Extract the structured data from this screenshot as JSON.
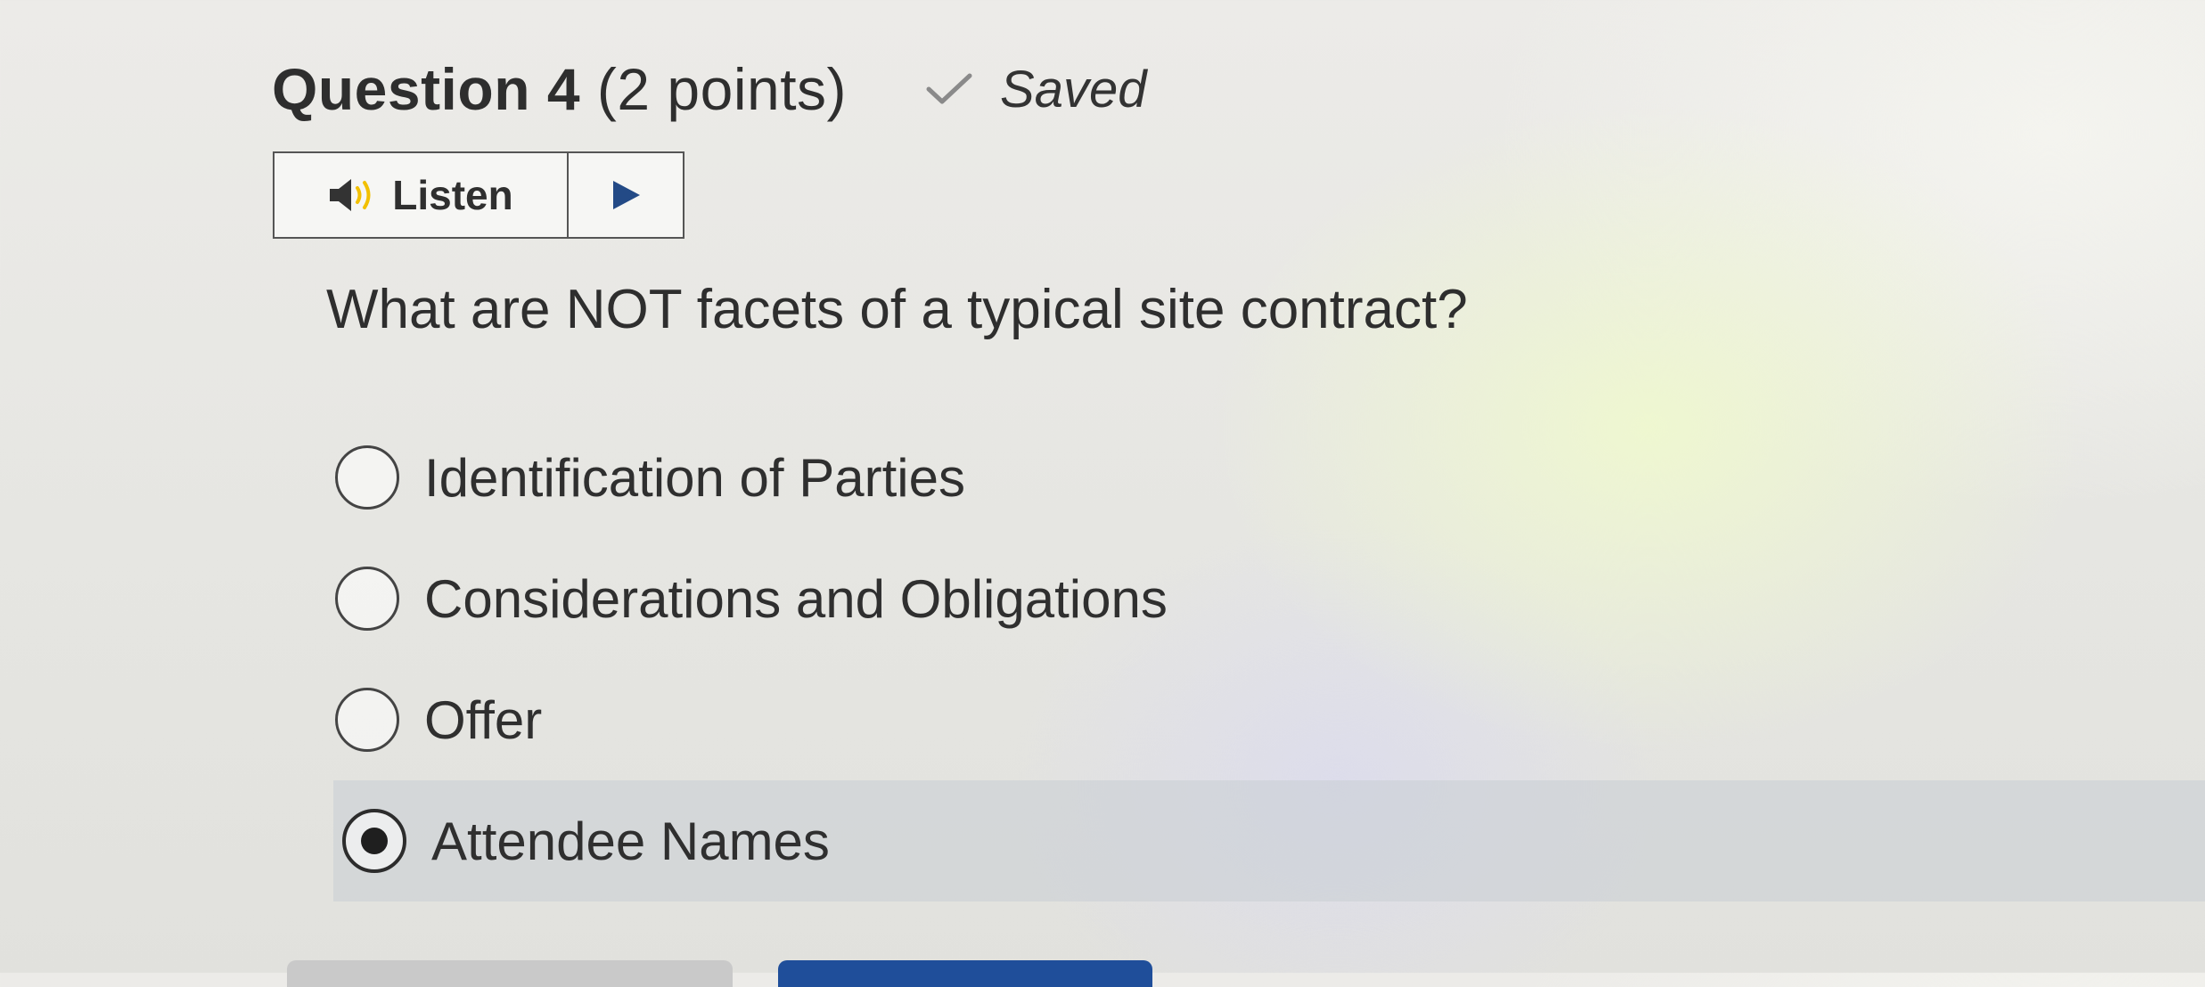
{
  "question": {
    "title": "Question 4",
    "points": "(2 points)",
    "saved_status": "Saved",
    "prompt": "What are NOT facets of a typical site contract?"
  },
  "listen": {
    "label": "Listen",
    "speaker_icon": "speaker-icon",
    "play_icon": "play-icon"
  },
  "options": [
    {
      "label": "Identification of Parties",
      "selected": false
    },
    {
      "label": "Considerations and Obligations",
      "selected": false
    },
    {
      "label": "Offer",
      "selected": false
    },
    {
      "label": "Attendee Names",
      "selected": true
    }
  ],
  "colors": {
    "text": "#2f2f2f",
    "selected_row": "#c8cdd4",
    "primary_button": "#1f4e9a"
  }
}
